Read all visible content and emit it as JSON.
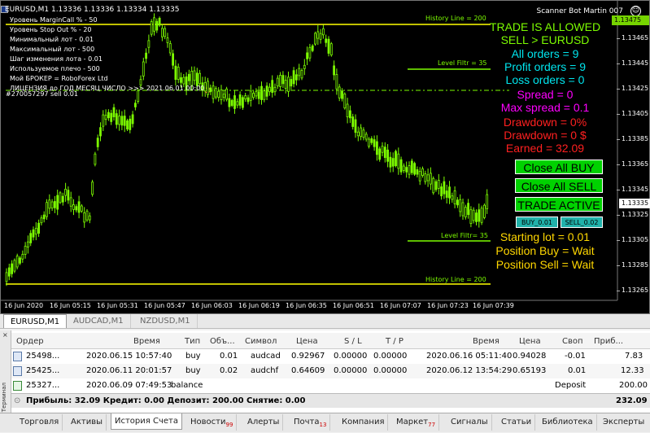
{
  "chart": {
    "title": "EURUSD,M1  1.13336 1.13336 1.13334 1.13335",
    "bot_name": "Scanner Bot Martin 007",
    "smiley": "☺",
    "current_price": "1.13335",
    "history_price": "1.13475",
    "price_labels": [
      "1.13465",
      "1.13445",
      "1.13425",
      "1.13405",
      "1.13385",
      "1.13365",
      "1.13345",
      "1.13325",
      "1.13305",
      "1.13285",
      "1.13265"
    ],
    "time_labels": [
      "16 Jun 2020",
      "16 Jun 05:15",
      "16 Jun 05:31",
      "16 Jun 05:47",
      "16 Jun 06:03",
      "16 Jun 06:19",
      "16 Jun 06:35",
      "16 Jun 06:51",
      "16 Jun 07:07",
      "16 Jun 07:23",
      "16 Jun 07:39"
    ],
    "line_labels": {
      "history_top": "History Line = 200",
      "level_top": "Level Filtr = 35",
      "level_bottom": "Level Filtr= 35",
      "history_bottom": "History Line = 200",
      "mid_line": "#270057297 sell 0.01"
    },
    "info_lines": [
      "Уровень MarginCall % - 50",
      "Уровень Stop Out % - 20",
      "Минимальный лот -  0.01",
      "Максимальный лот -  500",
      "Шаг изменения лота  - 0.01",
      "Используемое плечо - 500",
      "Мой БРОКЕР  = RoboForex Ltd",
      "ЛИЦЕНЗИЯ до ГОД  МЕСЯЦ  ЧИСЛО >>> 2021.06.01 00:00"
    ],
    "panel": {
      "trade_allowed": "TRADE IS ALLOWED",
      "sell_symbol": "SELL > EURUSD",
      "all_orders": "All orders = 9",
      "profit_orders": "Profit orders = 9",
      "loss_orders": "Loss orders = 0",
      "spread": "Spread =  0",
      "max_spread": "Max spread =  0.1",
      "drawdown_pct": "Drawdown = 0%",
      "drawdown_usd": "Drawdown = 0 $",
      "earned": "Earned = 32.09",
      "close_buy": "Close All BUY",
      "close_sell": "Close All SELL",
      "trade_active": "TRADE ACTIVE",
      "buy_btn": "BUY_0.01",
      "sell_btn": "SELL_0.02",
      "starting_lot": "Starting lot = 0.01",
      "position_buy": "Position Buy  = Wait",
      "position_sell": "Position Sell = Wait"
    },
    "colors": {
      "candles": "#7cfc00",
      "yellow_lines": "#ffff00",
      "cyan": "#00e5ee",
      "magenta": "#ff00ff",
      "red": "#ff2020",
      "yellow_text": "#ffd700"
    }
  },
  "symbol_tabs": [
    "EURUSD,M1",
    "AUDCAD,M1",
    "NZDUSD,M1"
  ],
  "table": {
    "headers": [
      "Ордер",
      "Время",
      "Тип",
      "Объ...",
      "Символ",
      "Цена",
      "S / L",
      "T / P",
      "Время",
      "Цена",
      "Своп",
      "Приб..."
    ],
    "rows": [
      [
        "25498...",
        "2020.06.15 10:57:40",
        "buy",
        "0.01",
        "audcad",
        "0.92967",
        "0.00000",
        "0.00000",
        "2020.06.16 05:11:40",
        "0.94028",
        "-0.01",
        "7.83"
      ],
      [
        "25425...",
        "2020.06.11 20:01:57",
        "buy",
        "0.02",
        "audchf",
        "0.64609",
        "0.00000",
        "0.00000",
        "2020.06.12 13:54:29",
        "0.65193",
        "0.01",
        "12.33"
      ]
    ],
    "balance_row": {
      "order": "25327...",
      "time": "2020.06.09 07:49:53",
      "type": "balance",
      "label": "Deposit",
      "amount": "200.00"
    },
    "summary": "Прибыль: 32.09  Кредит: 0.00  Депозит: 200.00  Снятие: 0.00",
    "summary_total": "232.09"
  },
  "terminal_label": "Терминал",
  "bottom_tabs": [
    {
      "label": "Торговля",
      "badge": ""
    },
    {
      "label": "Активы",
      "badge": ""
    },
    {
      "label": "История Счета",
      "badge": ""
    },
    {
      "label": "Новости",
      "badge": "99"
    },
    {
      "label": "Алерты",
      "badge": ""
    },
    {
      "label": "Почта",
      "badge": "13"
    },
    {
      "label": "Компания",
      "badge": ""
    },
    {
      "label": "Маркет",
      "badge": "77"
    },
    {
      "label": "Сигналы",
      "badge": ""
    },
    {
      "label": "Статьи",
      "badge": ""
    },
    {
      "label": "Библиотека",
      "badge": ""
    },
    {
      "label": "Эксперты",
      "badge": ""
    }
  ]
}
